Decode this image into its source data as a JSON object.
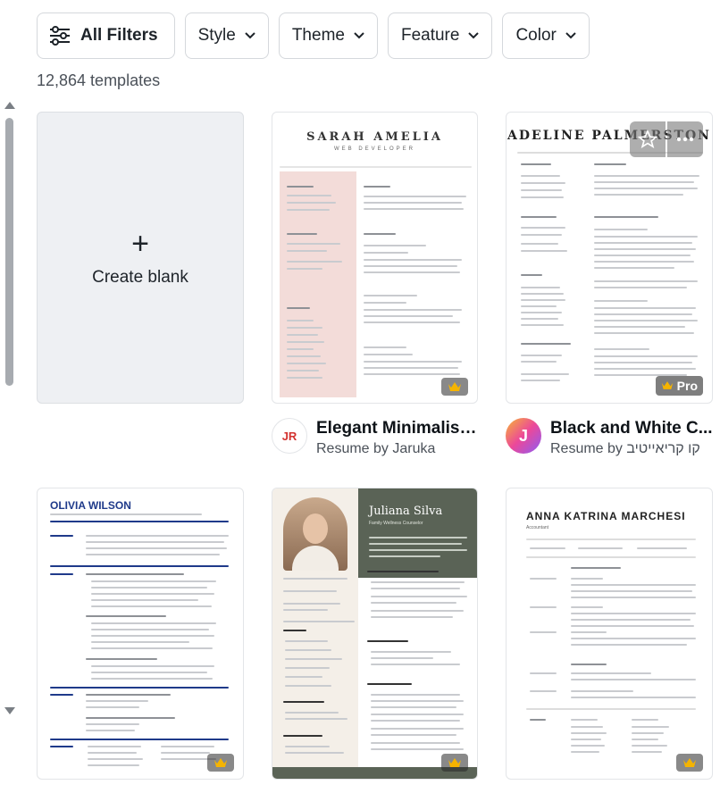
{
  "filters": {
    "all": "All Filters",
    "style": "Style",
    "theme": "Theme",
    "feature": "Feature",
    "color": "Color"
  },
  "count": "12,864 templates",
  "blank": {
    "plus": "+",
    "label": "Create blank"
  },
  "cards": [
    {
      "preview_name": "SARAH AMELIA",
      "preview_role": "WEB DEVELOPER",
      "title": "Elegant Minimalist...",
      "subtitle": "Resume by Jaruka",
      "avatar_text": "JR"
    },
    {
      "preview_name": "ADELINE PALMERSTON",
      "title": "Black and White C...",
      "subtitle": "Resume by קו קריאייטיב",
      "avatar_text": "J",
      "badge": "Pro"
    },
    {
      "preview_name": "OLIVIA WILSON"
    },
    {
      "preview_name": "Juliana Silva",
      "preview_role": "Family Wellness Counselor"
    },
    {
      "preview_name": "ANNA KATRINA MARCHESI",
      "preview_role": "Accountant"
    }
  ],
  "colors": {
    "accent_pink": "#f3dcd9",
    "green": "#5a6356",
    "purple_avatar": "#8b5cf6"
  }
}
